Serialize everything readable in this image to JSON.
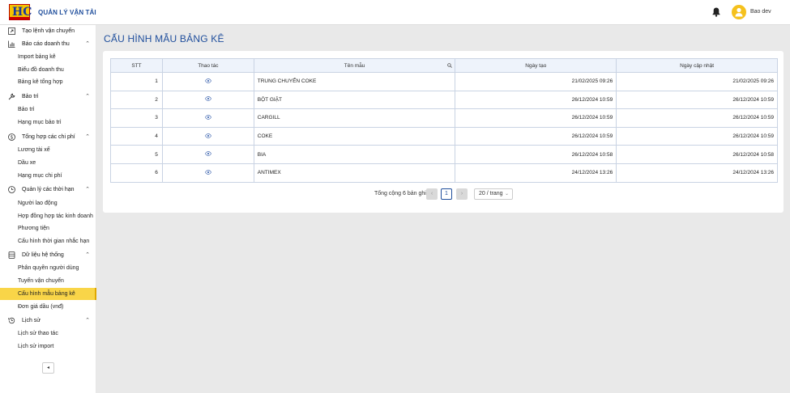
{
  "header": {
    "app_title": "QUẢN LÝ VẬN TẢI",
    "user_name": "Bao dev",
    "logo_text": "HC"
  },
  "sidebar": {
    "items": [
      {
        "type": "group",
        "label": "Tạo lệnh vận chuyển",
        "icon": "external-link-icon",
        "chevron": ""
      },
      {
        "type": "group",
        "label": "Báo cáo doanh thu",
        "icon": "bar-chart-icon",
        "chevron": "^"
      },
      {
        "type": "sub",
        "label": "Import bảng kê"
      },
      {
        "type": "sub",
        "label": "Biểu đồ doanh thu"
      },
      {
        "type": "sub",
        "label": "Bảng kê tổng hợp"
      },
      {
        "type": "group",
        "label": "Bảo trì",
        "icon": "wrench-icon",
        "chevron": "^"
      },
      {
        "type": "sub",
        "label": "Bảo trì"
      },
      {
        "type": "sub",
        "label": "Hạng mục bảo trì"
      },
      {
        "type": "group",
        "label": "Tổng hợp các chi phí",
        "icon": "dollar-icon",
        "chevron": "^"
      },
      {
        "type": "sub",
        "label": "Lương tài xế"
      },
      {
        "type": "sub",
        "label": "Dầu xe"
      },
      {
        "type": "sub",
        "label": "Hạng mục chi phí"
      },
      {
        "type": "group",
        "label": "Quản lý các thời hạn",
        "icon": "clock-icon",
        "chevron": "^"
      },
      {
        "type": "sub",
        "label": "Người lao động"
      },
      {
        "type": "sub",
        "label": "Hợp đồng hợp tác kinh doanh"
      },
      {
        "type": "sub",
        "label": "Phương tiện"
      },
      {
        "type": "sub",
        "label": "Cấu hình thời gian nhắc hạn"
      },
      {
        "type": "group",
        "label": "Dữ liệu hệ thống",
        "icon": "database-icon",
        "chevron": "^"
      },
      {
        "type": "sub",
        "label": "Phân quyền người dùng"
      },
      {
        "type": "sub",
        "label": "Tuyến vận chuyển"
      },
      {
        "type": "sub",
        "label": "Cấu hình mẫu bảng kê",
        "active": true
      },
      {
        "type": "sub",
        "label": "Đơn giá dầu (vnđ)"
      },
      {
        "type": "group",
        "label": "Lịch sử",
        "icon": "history-icon",
        "chevron": "^"
      },
      {
        "type": "sub",
        "label": "Lịch sử thao tác"
      },
      {
        "type": "sub",
        "label": "Lịch sử import"
      }
    ],
    "collapse_label": "◂"
  },
  "main": {
    "page_title": "CẤU HÌNH MẪU BẢNG KÊ",
    "table": {
      "columns": [
        "STT",
        "Thao tác",
        "Tên mẫu",
        "Ngày tạo",
        "Ngày cập nhật"
      ],
      "rows": [
        {
          "stt": "1",
          "name": "TRUNG CHUYỂN COKE",
          "created": "21/02/2025 09:26",
          "updated": "21/02/2025 09:26"
        },
        {
          "stt": "2",
          "name": "BỘT GIẶT",
          "created": "26/12/2024 10:59",
          "updated": "26/12/2024 10:59"
        },
        {
          "stt": "3",
          "name": "CARGILL",
          "created": "26/12/2024 10:59",
          "updated": "26/12/2024 10:59"
        },
        {
          "stt": "4",
          "name": "COKE",
          "created": "26/12/2024 10:59",
          "updated": "26/12/2024 10:59"
        },
        {
          "stt": "5",
          "name": "BIA",
          "created": "26/12/2024 10:58",
          "updated": "26/12/2024 10:58"
        },
        {
          "stt": "6",
          "name": "ANTIMEX",
          "created": "24/12/2024 13:26",
          "updated": "24/12/2024 13:26"
        }
      ]
    },
    "pagination": {
      "total_text": "Tổng cộng 6 bản ghi",
      "prev": "‹",
      "next": "›",
      "current_page": "1",
      "page_size": "20 / trang"
    }
  },
  "colors": {
    "primary": "#1f4e9c",
    "active_bg": "#f9d548",
    "header_bg": "#ffffff",
    "content_bg": "#e9e9e9",
    "table_header_bg": "#eef3fb"
  }
}
